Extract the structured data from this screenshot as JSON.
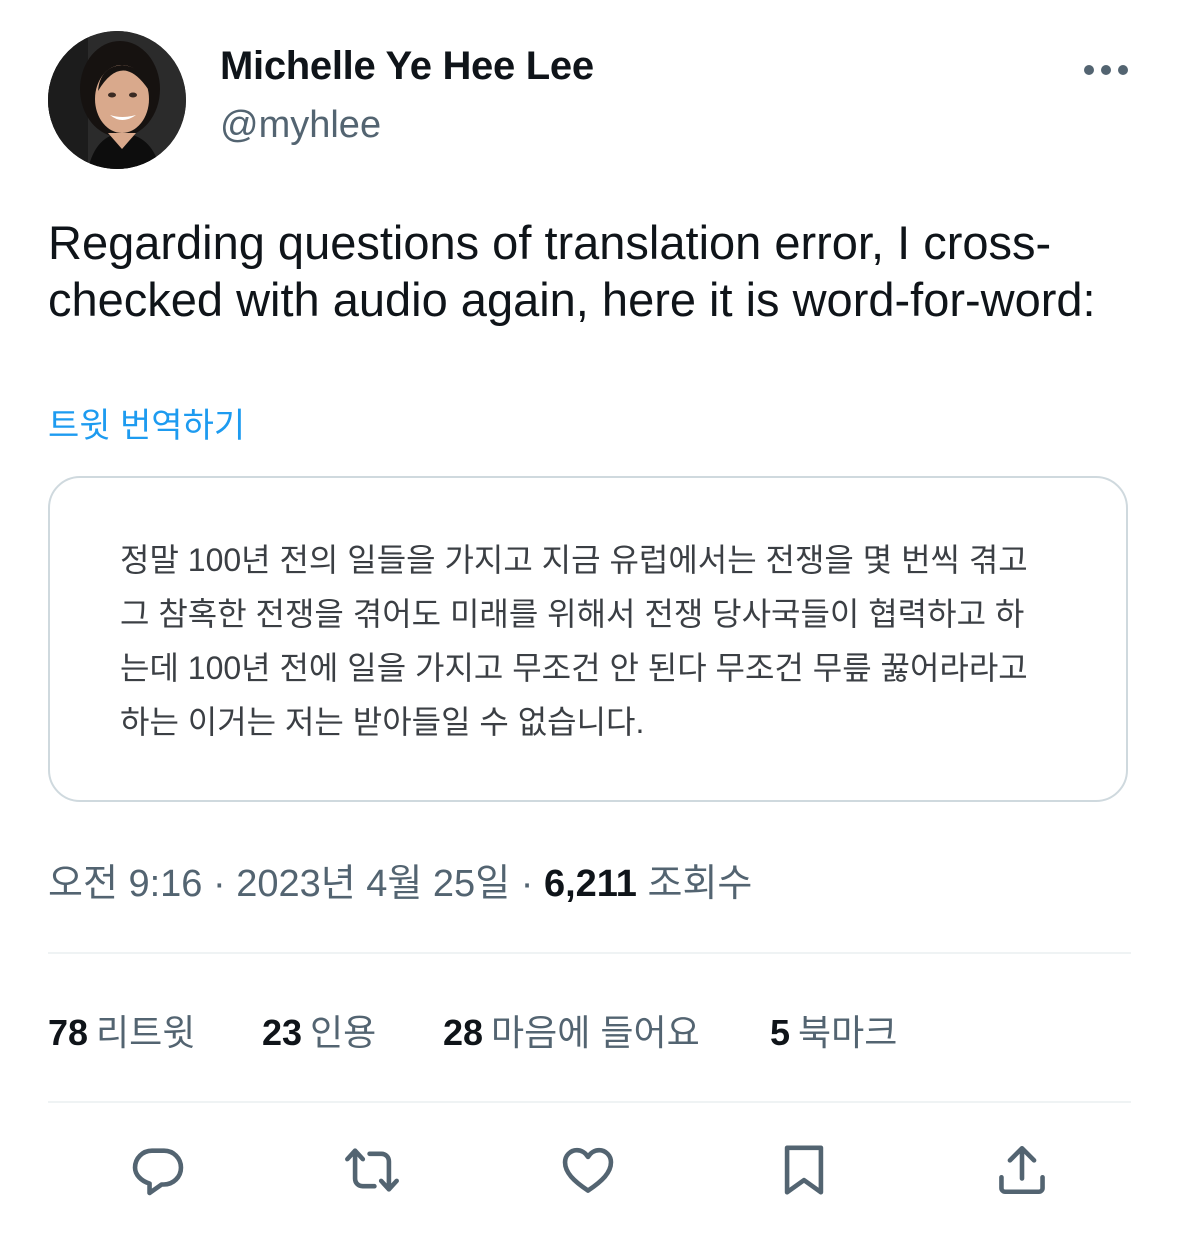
{
  "author": {
    "name": "Michelle Ye Hee Lee",
    "handle": "@myhlee"
  },
  "tweet": {
    "text": "Regarding questions of translation error, I cross-checked with audio again, here it is word-for-word:",
    "translate_label": "트윗 번역하기"
  },
  "media": {
    "quote_text": "정말 100년 전의 일들을 가지고 지금 유럽에서는 전쟁을 몇 번씩 겪고 그 참혹한 전쟁을 겪어도 미래를 위해서 전쟁 당사국들이 협력하고 하는데 100년 전에 일을 가지고 무조건 안 된다 무조건 무릎 꿇어라라고 하는 이거는 저는 받아들일 수 없습니다."
  },
  "meta": {
    "time": "오전 9:16",
    "separator": "·",
    "date": "2023년 4월 25일",
    "views_count": "6,211",
    "views_label": "조회수"
  },
  "stats": [
    {
      "count": "78",
      "label": "리트윗"
    },
    {
      "count": "23",
      "label": "인용"
    },
    {
      "count": "28",
      "label": "마음에 들어요"
    },
    {
      "count": "5",
      "label": "북마크"
    }
  ],
  "actions": [
    "reply-icon",
    "retweet-icon",
    "like-icon",
    "bookmark-icon",
    "share-icon"
  ],
  "colors": {
    "link": "#1d9bf0",
    "text_primary": "#0f1419",
    "text_secondary": "#536471",
    "border": "#cfd9de"
  }
}
